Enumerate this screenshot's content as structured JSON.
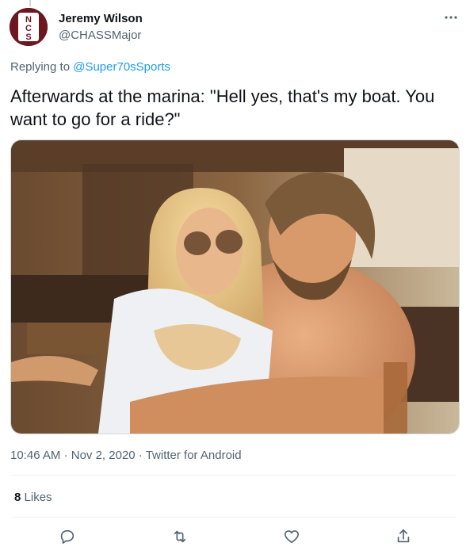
{
  "author": {
    "name": "Jeremy Wilson",
    "handle": "@CHASSMajor",
    "avatar_letters": "NCS",
    "avatar_bg": "#6b1820"
  },
  "reply": {
    "prefix": "Replying to",
    "to": "@Super70sSports"
  },
  "tweet": {
    "text": "Afterwards at the marina: \"Hell yes, that's my boat. You want to go for a ride?\""
  },
  "meta": {
    "time": "10:46 AM",
    "date": "Nov 2, 2020",
    "source": "Twitter for Android",
    "separator": "·"
  },
  "stats": {
    "likes_count": "8",
    "likes_label": "Likes"
  },
  "icons": {
    "more": "more-icon",
    "reply": "reply-icon",
    "retweet": "retweet-icon",
    "like": "heart-icon",
    "share": "share-icon"
  },
  "colors": {
    "link": "#1d9bf0",
    "secondary": "#536471",
    "primary": "#0f1419"
  }
}
